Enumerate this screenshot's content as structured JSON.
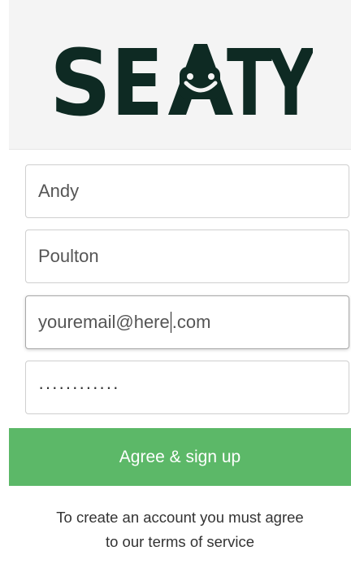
{
  "brand": {
    "logo_text": "SEATY",
    "color": "#0e2a23"
  },
  "form": {
    "first_name": "Andy",
    "last_name": "Poulton",
    "email_before_caret": "youremail@here",
    "email_after_caret": ".com",
    "password_mask": "············"
  },
  "signup": {
    "button_label": "Agree & sign up",
    "button_color": "#5cb868"
  },
  "terms": {
    "line1": "To create an account you must agree",
    "line2": "to our terms of service"
  }
}
